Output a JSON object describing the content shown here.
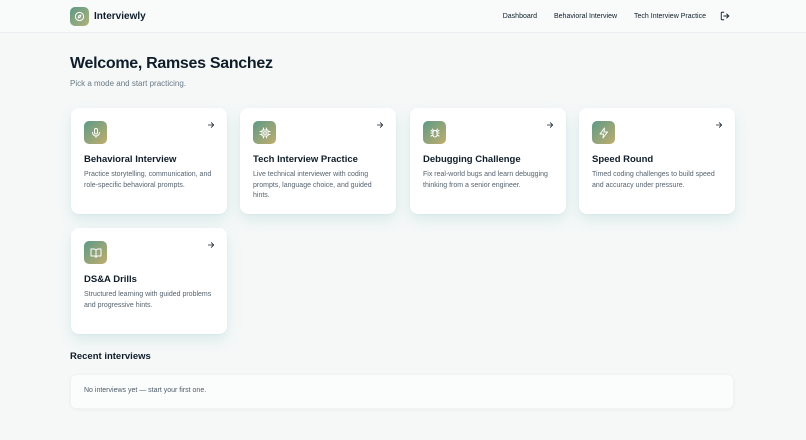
{
  "app": {
    "name": "Interviewly",
    "logo_icon": "compass-icon"
  },
  "nav": {
    "items": [
      {
        "label": "Dashboard"
      },
      {
        "label": "Behavioral Interview"
      },
      {
        "label": "Tech Interview Practice"
      }
    ],
    "logout_icon": "logout-icon"
  },
  "welcome": {
    "title": "Welcome, Ramses Sanchez",
    "subtitle": "Pick a mode and start practicing."
  },
  "cards": [
    {
      "title": "Behavioral Interview",
      "description": "Practice storytelling, communication, and role-specific behavioral prompts.",
      "icon": "microphone-icon"
    },
    {
      "title": "Tech Interview Practice",
      "description": "Live technical interviewer with coding prompts, language choice, and guided hints.",
      "icon": "cpu-icon"
    },
    {
      "title": "Debugging Challenge",
      "description": "Fix real-world bugs and learn debugging thinking from a senior engineer.",
      "icon": "bug-icon"
    },
    {
      "title": "Speed Round",
      "description": "Timed coding challenges to build speed and accuracy under pressure.",
      "icon": "lightning-icon"
    },
    {
      "title": "DS&A Drills",
      "description": "Structured learning with guided problems and progressive hints.",
      "icon": "book-icon"
    }
  ],
  "recent": {
    "title": "Recent interviews",
    "empty_text": "No interviews yet — start your first one."
  },
  "colors": {
    "accent_start": "#5d9a86",
    "accent_end": "#c0ad6e",
    "text": "#0f1d2a",
    "muted": "#6a7a86"
  }
}
